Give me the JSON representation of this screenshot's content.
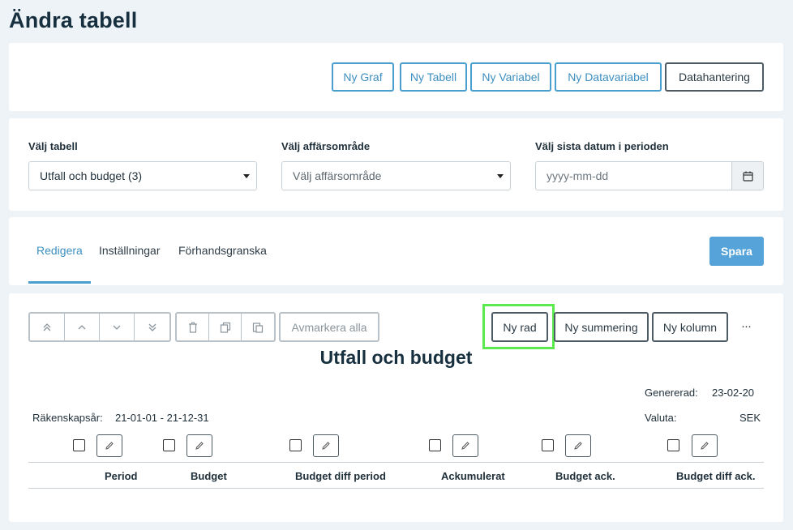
{
  "page": {
    "title": "Ändra tabell"
  },
  "toolbar": {
    "new_graph": "Ny Graf",
    "new_table": "Ny Tabell",
    "new_variable": "Ny Variabel",
    "new_datavariable": "Ny Datavariabel",
    "data_management": "Datahantering"
  },
  "selects": {
    "table_label": "Välj tabell",
    "table_value": "Utfall och budget (3)",
    "area_label": "Välj affärsområde",
    "area_placeholder": "Välj affärsområde",
    "date_label": "Välj sista datum i perioden",
    "date_placeholder": "yyyy-mm-dd"
  },
  "tabs": {
    "items": [
      "Redigera",
      "Inställningar",
      "Förhandsgranska"
    ],
    "active": "Redigera",
    "save": "Spara"
  },
  "table_toolbar": {
    "deselect_all": "Avmarkera alla",
    "new_row": "Ny rad",
    "new_sum": "Ny summering",
    "new_column": "Ny kolumn",
    "more": "···"
  },
  "table": {
    "title": "Utfall och budget",
    "generated_label": "Genererad:",
    "generated_value": "23-02-20",
    "fiscal_year_label": "Räkenskapsår:",
    "fiscal_year_value": "21-01-01 - 21-12-31",
    "currency_label": "Valuta:",
    "currency_value": "SEK",
    "columns": [
      "Period",
      "Budget",
      "Budget diff period",
      "Ackumulerat",
      "Budget ack.",
      "Budget diff ack."
    ]
  },
  "colors": {
    "accent": "#4b9fcf",
    "primary_button": "#55a3d8",
    "highlight": "#5bea4e",
    "background": "#eef3f7"
  }
}
